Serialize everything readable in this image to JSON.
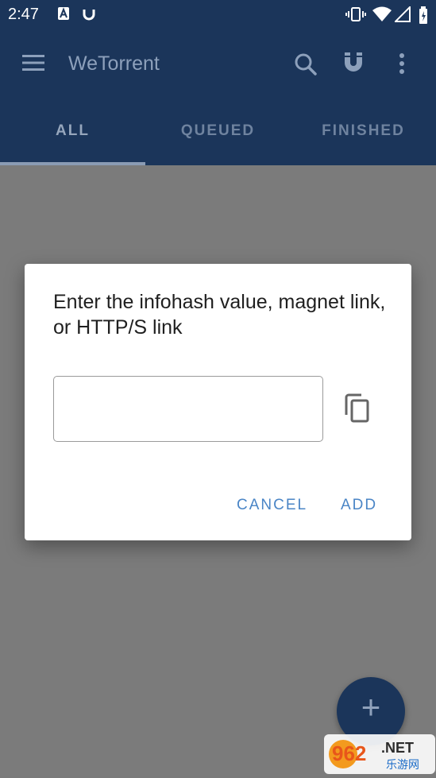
{
  "status_bar": {
    "time": "2:47"
  },
  "app_bar": {
    "title": "WeTorrent"
  },
  "tabs": [
    {
      "label": "ALL"
    },
    {
      "label": "QUEUED"
    },
    {
      "label": "FINISHED"
    }
  ],
  "dialog": {
    "title": "Enter the infohash value, magnet link, or HTTP/S link",
    "input_value": "",
    "cancel_label": "CANCEL",
    "add_label": "ADD"
  },
  "fab": {
    "icon": "plus-icon",
    "label": "+"
  },
  "watermark": {
    "text_number": "962",
    "text_suffix": ".NET",
    "text_cn": "乐游网"
  },
  "colors": {
    "primary": "#1b355a",
    "accent": "#4a85c6",
    "scrim": "#7b7b7b"
  }
}
